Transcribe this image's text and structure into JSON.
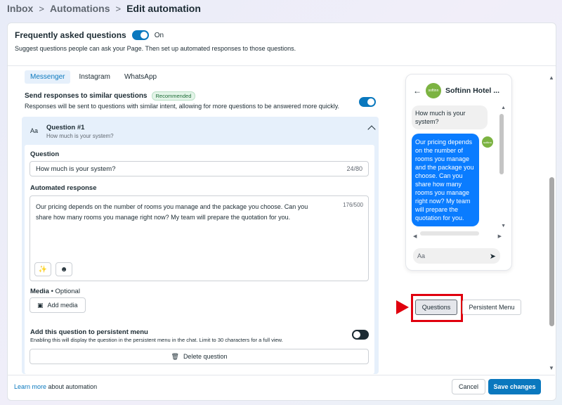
{
  "breadcrumb": {
    "items": [
      "Inbox",
      "Automations",
      "Edit automation"
    ]
  },
  "faq": {
    "title": "Frequently asked questions",
    "toggle_label": "On",
    "description": "Suggest questions people can ask your Page. Then set up automated responses to those questions."
  },
  "tabs": [
    "Messenger",
    "Instagram",
    "WhatsApp"
  ],
  "similar": {
    "title": "Send responses to similar questions",
    "badge": "Recommended",
    "description": "Responses will be sent to questions with similar intent, allowing for more questions to be answered more quickly."
  },
  "question": {
    "aa_icon": "Aa",
    "title": "Question #1",
    "subtitle": "How much is your system?",
    "field_label": "Question",
    "value": "How much is your system?",
    "counter": "24/80",
    "response_label": "Automated response",
    "response_text": "Our pricing depends on the number of rooms you manage and the package you choose. Can you share how many rooms you manage right now? My team will prepare the quotation for you.",
    "response_counter": "176/500",
    "media_label": "Media",
    "media_optional": " • Optional",
    "add_media": "Add media",
    "persist_title": "Add this question to persistent menu",
    "persist_desc": "Enabling this will display the question in the persistent menu in the chat. Limit to 30 characters for a full view.",
    "delete": "Delete question"
  },
  "preview": {
    "name": "Softinn Hotel ...",
    "avatar_text": "softinn",
    "incoming": "How much is your system?",
    "outgoing": "Our pricing depends on the number of rooms you manage and the package you choose. Can you share how many rooms you manage right now? My team will prepare the quotation for you.",
    "compose_placeholder": "Aa"
  },
  "preview_buttons": {
    "questions": "Questions",
    "persistent": "Persistent Menu"
  },
  "footer": {
    "learn_link": "Learn more",
    "learn_rest": " about automation",
    "cancel": "Cancel",
    "save": "Save changes"
  },
  "colors": {
    "accent": "#0a78be",
    "highlight": "#e0000e"
  }
}
